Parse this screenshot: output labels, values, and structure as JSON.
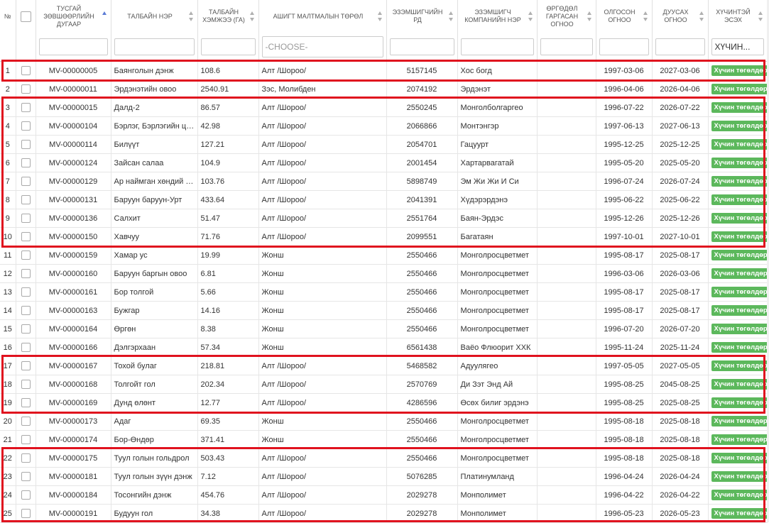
{
  "header": {
    "no": "№",
    "license_no": "ТУСГАЙ ЗӨВШӨӨРЛИЙН ДУГААР",
    "area_name": "ТАЛБАЙН НЭР",
    "area_size": "ТАЛБАЙН ХЭМЖЭЭ (ГА)",
    "mineral_type": "АШИГТ МАЛТМАЛЫН ТӨРӨЛ",
    "owner_reg": "ЭЗЭМШИГЧИЙН РД",
    "owner_company": "ЭЗЭМШИГЧ КОМПАНИЙН НЭР",
    "applied_date": "ӨРГӨДӨЛ ГАРГАСАН ОГНОО",
    "granted_date": "ОЛГОСОН ОГНОО",
    "expiry_date": "ДУУСАХ ОГНОО",
    "valid_status": "ХҮЧИНТЭЙ ЭСЭХ"
  },
  "filters": {
    "mineral_placeholder": "-Choose-",
    "status_value": "Хүчин..."
  },
  "colors": {
    "badge": "#5cb85c",
    "highlight": "#e0121e",
    "sort_active": "#5b7bd5"
  },
  "rows": [
    {
      "no": "1",
      "license": "MV-00000005",
      "name": "Баянголын дэнж",
      "size": "108.6",
      "mineral": "Алт /Шороо/",
      "reg": "5157145",
      "company": "Хос богд",
      "applied": "",
      "granted": "1997-03-06",
      "expiry": "2027-03-06",
      "status": "Хүчин төгөлдөр"
    },
    {
      "no": "2",
      "license": "MV-00000011",
      "name": "Эрдэнэтийн овоо",
      "size": "2540.91",
      "mineral": "Зэс, Молибден",
      "reg": "2074192",
      "company": "Эрдэнэт",
      "applied": "",
      "granted": "1996-04-06",
      "expiry": "2026-04-06",
      "status": "Хүчин төгөлдөр"
    },
    {
      "no": "3",
      "license": "MV-00000015",
      "name": "Далд-2",
      "size": "86.57",
      "mineral": "Алт /Шороо/",
      "reg": "2550245",
      "company": "Монголболгаргео",
      "applied": "",
      "granted": "1996-07-22",
      "expiry": "2026-07-22",
      "status": "Хүчин төгөлдөр"
    },
    {
      "no": "4",
      "license": "MV-00000104",
      "name": "Бэрлэг, Бэрлэгийн цагаан",
      "size": "42.98",
      "mineral": "Алт /Шороо/",
      "reg": "2066866",
      "company": "Монтэнгэр",
      "applied": "",
      "granted": "1997-06-13",
      "expiry": "2027-06-13",
      "status": "Хүчин төгөлдөр"
    },
    {
      "no": "5",
      "license": "MV-00000114",
      "name": "Билүүт",
      "size": "127.21",
      "mineral": "Алт /Шороо/",
      "reg": "2054701",
      "company": "Гацуурт",
      "applied": "",
      "granted": "1995-12-25",
      "expiry": "2025-12-25",
      "status": "Хүчин төгөлдөр"
    },
    {
      "no": "6",
      "license": "MV-00000124",
      "name": "Зайсан салаа",
      "size": "104.9",
      "mineral": "Алт /Шороо/",
      "reg": "2001454",
      "company": "Хартарвагатай",
      "applied": "",
      "granted": "1995-05-20",
      "expiry": "2025-05-20",
      "status": "Хүчин төгөлдөр"
    },
    {
      "no": "7",
      "license": "MV-00000129",
      "name": "Ар наймган хөндий дорнод",
      "size": "103.76",
      "mineral": "Алт /Шороо/",
      "reg": "5898749",
      "company": "Эм Жи Жи И Си",
      "applied": "",
      "granted": "1996-07-24",
      "expiry": "2026-07-24",
      "status": "Хүчин төгөлдөр"
    },
    {
      "no": "8",
      "license": "MV-00000131",
      "name": "Баруун баруун-Урт",
      "size": "433.64",
      "mineral": "Алт /Шороо/",
      "reg": "2041391",
      "company": "Хүдэрэрдэнэ",
      "applied": "",
      "granted": "1995-06-22",
      "expiry": "2025-06-22",
      "status": "Хүчин төгөлдөр"
    },
    {
      "no": "9",
      "license": "MV-00000136",
      "name": "Салхит",
      "size": "51.47",
      "mineral": "Алт /Шороо/",
      "reg": "2551764",
      "company": "Баян-Эрдэс",
      "applied": "",
      "granted": "1995-12-26",
      "expiry": "2025-12-26",
      "status": "Хүчин төгөлдөр"
    },
    {
      "no": "10",
      "license": "MV-00000150",
      "name": "Хавчуу",
      "size": "71.76",
      "mineral": "Алт /Шороо/",
      "reg": "2099551",
      "company": "Багатаян",
      "applied": "",
      "granted": "1997-10-01",
      "expiry": "2027-10-01",
      "status": "Хүчин төгөлдөр"
    },
    {
      "no": "11",
      "license": "MV-00000159",
      "name": "Хамар ус",
      "size": "19.99",
      "mineral": "Жонш",
      "reg": "2550466",
      "company": "Монголросцветмет",
      "applied": "",
      "granted": "1995-08-17",
      "expiry": "2025-08-17",
      "status": "Хүчин төгөлдөр"
    },
    {
      "no": "12",
      "license": "MV-00000160",
      "name": "Баруун баргын овоо",
      "size": "6.81",
      "mineral": "Жонш",
      "reg": "2550466",
      "company": "Монголросцветмет",
      "applied": "",
      "granted": "1996-03-06",
      "expiry": "2026-03-06",
      "status": "Хүчин төгөлдөр"
    },
    {
      "no": "13",
      "license": "MV-00000161",
      "name": "Бор толгой",
      "size": "5.66",
      "mineral": "Жонш",
      "reg": "2550466",
      "company": "Монголросцветмет",
      "applied": "",
      "granted": "1995-08-17",
      "expiry": "2025-08-17",
      "status": "Хүчин төгөлдөр"
    },
    {
      "no": "14",
      "license": "MV-00000163",
      "name": "Бужгар",
      "size": "14.16",
      "mineral": "Жонш",
      "reg": "2550466",
      "company": "Монголросцветмет",
      "applied": "",
      "granted": "1995-08-17",
      "expiry": "2025-08-17",
      "status": "Хүчин төгөлдөр"
    },
    {
      "no": "15",
      "license": "MV-00000164",
      "name": "Өргөн",
      "size": "8.38",
      "mineral": "Жонш",
      "reg": "2550466",
      "company": "Монголросцветмет",
      "applied": "",
      "granted": "1996-07-20",
      "expiry": "2026-07-20",
      "status": "Хүчин төгөлдөр"
    },
    {
      "no": "16",
      "license": "MV-00000166",
      "name": "Дэлгэрхаан",
      "size": "57.34",
      "mineral": "Жонш",
      "reg": "6561438",
      "company": "Ваёо Флюорит ХХК",
      "applied": "",
      "granted": "1995-11-24",
      "expiry": "2025-11-24",
      "status": "Хүчин төгөлдөр"
    },
    {
      "no": "17",
      "license": "MV-00000167",
      "name": "Тохой булаг",
      "size": "218.81",
      "mineral": "Алт /Шороо/",
      "reg": "5468582",
      "company": "Адуулягео",
      "applied": "",
      "granted": "1997-05-05",
      "expiry": "2027-05-05",
      "status": "Хүчин төгөлдөр"
    },
    {
      "no": "18",
      "license": "MV-00000168",
      "name": "Толгойт гол",
      "size": "202.34",
      "mineral": "Алт /Шороо/",
      "reg": "2570769",
      "company": "Ди Зэт Энд Ай",
      "applied": "",
      "granted": "1995-08-25",
      "expiry": "2045-08-25",
      "status": "Хүчин төгөлдөр"
    },
    {
      "no": "19",
      "license": "MV-00000169",
      "name": "Дунд өлөнт",
      "size": "12.77",
      "mineral": "Алт /Шороо/",
      "reg": "4286596",
      "company": "Өсөх билиг эрдэнэ",
      "applied": "",
      "granted": "1995-08-25",
      "expiry": "2025-08-25",
      "status": "Хүчин төгөлдөр"
    },
    {
      "no": "20",
      "license": "MV-00000173",
      "name": "Адаг",
      "size": "69.35",
      "mineral": "Жонш",
      "reg": "2550466",
      "company": "Монголросцветмет",
      "applied": "",
      "granted": "1995-08-18",
      "expiry": "2025-08-18",
      "status": "Хүчин төгөлдөр"
    },
    {
      "no": "21",
      "license": "MV-00000174",
      "name": "Бор-Өндөр",
      "size": "371.41",
      "mineral": "Жонш",
      "reg": "2550466",
      "company": "Монголросцветмет",
      "applied": "",
      "granted": "1995-08-18",
      "expiry": "2025-08-18",
      "status": "Хүчин төгөлдөр"
    },
    {
      "no": "22",
      "license": "MV-00000175",
      "name": "Туул голын гольдрол",
      "size": "503.43",
      "mineral": "Алт /Шороо/",
      "reg": "2550466",
      "company": "Монголросцветмет",
      "applied": "",
      "granted": "1995-08-18",
      "expiry": "2025-08-18",
      "status": "Хүчин төгөлдөр"
    },
    {
      "no": "23",
      "license": "MV-00000181",
      "name": "Туул голын зүүн дэнж",
      "size": "7.12",
      "mineral": "Алт /Шороо/",
      "reg": "5076285",
      "company": "Платинумланд",
      "applied": "",
      "granted": "1996-04-24",
      "expiry": "2026-04-24",
      "status": "Хүчин төгөлдөр"
    },
    {
      "no": "24",
      "license": "MV-00000184",
      "name": "Тосонгийн дэнж",
      "size": "454.76",
      "mineral": "Алт /Шороо/",
      "reg": "2029278",
      "company": "Монполимет",
      "applied": "",
      "granted": "1996-04-22",
      "expiry": "2026-04-22",
      "status": "Хүчин төгөлдөр"
    },
    {
      "no": "25",
      "license": "MV-00000191",
      "name": "Будуун гол",
      "size": "34.38",
      "mineral": "Алт /Шороо/",
      "reg": "2029278",
      "company": "Монполимет",
      "applied": "",
      "granted": "1996-05-23",
      "expiry": "2026-05-23",
      "status": "Хүчин төгөлдөр"
    }
  ],
  "highlight_groups": [
    {
      "from": 0,
      "to": 0
    },
    {
      "from": 2,
      "to": 9
    },
    {
      "from": 16,
      "to": 18
    },
    {
      "from": 21,
      "to": 24
    }
  ]
}
